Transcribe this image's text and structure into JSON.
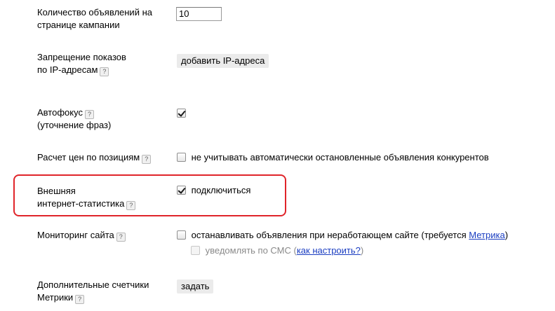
{
  "rows": {
    "ads_per_page": {
      "label_line1": "Количество объявлений на",
      "label_line2": "странице кампании",
      "value": "10"
    },
    "ip_block": {
      "label_line1": "Запрещение показов",
      "label_line2": "по IP-адресам",
      "button": "добавить IP-адреса"
    },
    "autofocus": {
      "label_line1": "Автофокус",
      "label_line2": "(уточнение фраз)"
    },
    "price_calc": {
      "label": "Расчет цен по позициям",
      "checkbox_label": "не учитывать автоматически остановленные объявления конкурентов"
    },
    "external_stats": {
      "label_line1": "Внешняя",
      "label_line2": "интернет-статистика",
      "checkbox_label": "подключиться"
    },
    "site_monitoring": {
      "label": "Мониторинг сайта",
      "checkbox_label": "останавливать объявления при неработающем сайте (требуется ",
      "link": "Метрика",
      "suffix": ")",
      "sms_label": "уведомлять по СМС (",
      "sms_link": "как настроить?",
      "sms_suffix": ")"
    },
    "extra_counters": {
      "label_line1": "Дополнительные счетчики",
      "label_line2": "Метрики",
      "button": "задать"
    }
  },
  "help_icon": "?",
  "accent_colors": {
    "highlight": "#e0242a",
    "link": "#1a3dc1"
  }
}
